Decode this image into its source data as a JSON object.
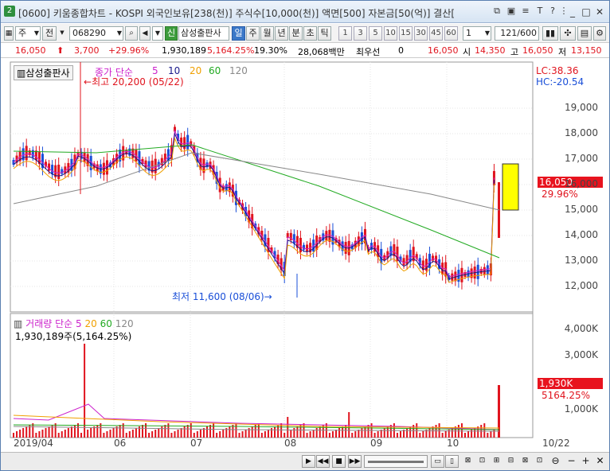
{
  "title": "[0600] 키움종합차트 - KOSPI 외국인보유[238(천)] 주식수[10,000(천)] 액면[500] 자본금[50(억)] 결산[",
  "app_icon": "2",
  "toolbar": {
    "market": "주",
    "prev_label": "전",
    "code": "068290",
    "sin_label": "신",
    "stock_name": "삼성출판사",
    "periods": [
      "일",
      "주",
      "월",
      "년",
      "분",
      "초",
      "틱"
    ],
    "selected_period": "일",
    "intervals": [
      "1",
      "3",
      "5",
      "10",
      "15",
      "30",
      "45",
      "60"
    ],
    "interval_value": "1",
    "count": "121",
    "count_total": "/600"
  },
  "quote": {
    "price": "16,050",
    "change": "3,700",
    "change_pct": "+29.96%",
    "volume": "1,930,189",
    "volume_pct": "5,164.25%",
    "turnover": "19.30%",
    "amount": "28,068백만",
    "preferred_label": "최우선",
    "preferred_value": "0",
    "best_price": "16,050",
    "open_label": "시",
    "open": "14,350",
    "high_label": "고",
    "high": "16,050",
    "low_label": "저",
    "low": "13,150"
  },
  "price_panel": {
    "name_tag": "삼성출판사",
    "ma_label": "종가 단순",
    "ma_periods": [
      "5",
      "10",
      "20",
      "60",
      "120"
    ],
    "high_note": "최고 20,200 (05/22)",
    "low_note": "최저 11,600 (08/06)",
    "lc": "LC:38.36",
    "hc": "HC:-20.54",
    "current_price": "16,050",
    "current_pct": "29.96%",
    "y_ticks": [
      "19,000",
      "18,000",
      "17,000",
      "16,000",
      "15,000",
      "14,000",
      "13,000",
      "12,000"
    ]
  },
  "volume_panel": {
    "ma_label": "거래량 단순",
    "ma_periods": [
      "5",
      "20",
      "60",
      "120"
    ],
    "current_text": "1,930,189주(5,164.25%)",
    "current_value": "1,930K",
    "current_pct": "5164.25%",
    "y_ticks": [
      "4,000K",
      "3,000K",
      "1,000K"
    ]
  },
  "x_axis": {
    "labels": [
      "2019/04",
      "06",
      "07",
      "08",
      "09",
      "10",
      "10/22"
    ]
  },
  "colors": {
    "up": "#e0141e",
    "down": "#1a4fd8",
    "ma5": "#cc22cc",
    "ma10": "#1a1a8a",
    "ma20": "#f0a000",
    "ma60": "#22aa22",
    "ma120": "#888888"
  }
}
